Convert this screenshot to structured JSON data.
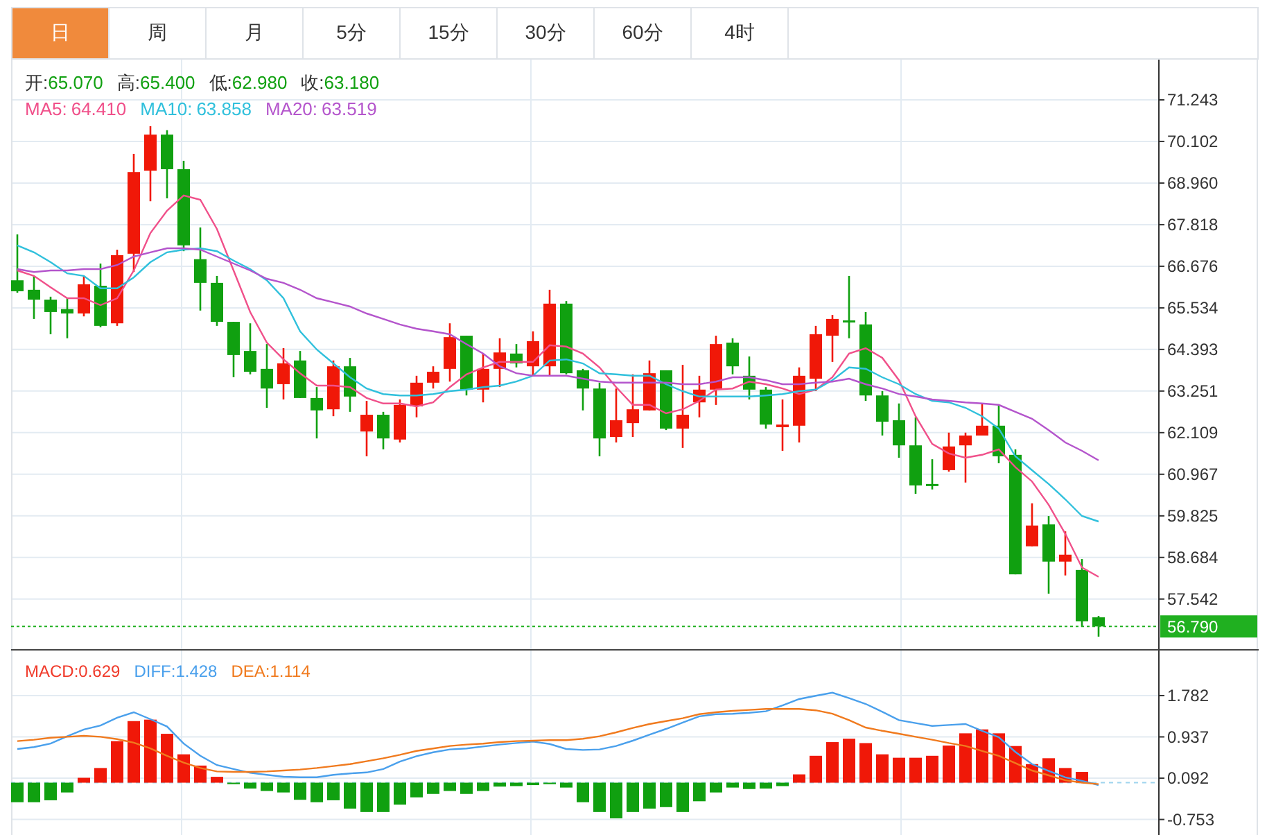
{
  "tabs": [
    {
      "label": "日",
      "selected": true
    },
    {
      "label": "周",
      "selected": false
    },
    {
      "label": "月",
      "selected": false
    },
    {
      "label": "5分",
      "selected": false
    },
    {
      "label": "15分",
      "selected": false
    },
    {
      "label": "30分",
      "selected": false
    },
    {
      "label": "60分",
      "selected": false
    },
    {
      "label": "4时",
      "selected": false
    }
  ],
  "price_chart": {
    "legend": {
      "ohlc": [
        {
          "label": "开:",
          "value": "65.070"
        },
        {
          "label": "高:",
          "value": "65.400"
        },
        {
          "label": "低:",
          "value": "62.980"
        },
        {
          "label": "收:",
          "value": "63.180"
        }
      ],
      "ma": [
        {
          "label": "MA5:",
          "value": "64.410",
          "color": "#f0508a"
        },
        {
          "label": "MA10:",
          "value": "63.858",
          "color": "#30c0dc"
        },
        {
          "label": "MA20:",
          "value": "63.519",
          "color": "#b455cc"
        }
      ]
    },
    "chart_data": {
      "type": "candlestick",
      "grid": true,
      "ylim": [
        56.167,
        72.347
      ],
      "yticks": [
        71.243,
        70.102,
        {
          "value": 68.96,
          "label": "68.960"
        },
        67.818,
        66.676,
        65.534,
        64.393,
        63.251,
        62.109,
        60.967,
        59.825,
        58.684,
        57.542
      ],
      "ref_lines": [
        {
          "axis": "y",
          "value": 56.79,
          "color": "#20b020",
          "label": "56.790"
        }
      ],
      "ohlc": [
        [
          66.29,
          67.55,
          65.95,
          65.99
        ],
        [
          66.03,
          66.41,
          65.23,
          65.76
        ],
        [
          65.76,
          65.84,
          64.81,
          65.42
        ],
        [
          65.5,
          65.8,
          64.7,
          65.38
        ],
        [
          65.38,
          66.41,
          65.3,
          66.18
        ],
        [
          66.14,
          66.75,
          65.0,
          65.04
        ],
        [
          65.11,
          67.13,
          65.04,
          66.98
        ],
        [
          67.02,
          69.76,
          66.52,
          69.26
        ],
        [
          69.3,
          70.52,
          68.46,
          70.29
        ],
        [
          70.29,
          70.41,
          68.54,
          69.34
        ],
        [
          69.34,
          69.57,
          67.09,
          67.25
        ],
        [
          66.87,
          67.74,
          65.46,
          66.22
        ],
        [
          66.22,
          66.41,
          65.04,
          65.15
        ],
        [
          65.15,
          65.15,
          63.63,
          64.24
        ],
        [
          64.35,
          65.11,
          63.71,
          63.78
        ],
        [
          63.86,
          64.54,
          62.79,
          63.32
        ],
        [
          63.44,
          64.43,
          63.02,
          64.01
        ],
        [
          64.09,
          64.35,
          63.06,
          63.06
        ],
        [
          63.06,
          63.36,
          61.95,
          62.72
        ],
        [
          62.75,
          64.09,
          62.56,
          63.93
        ],
        [
          63.93,
          64.16,
          62.68,
          63.1
        ],
        [
          62.14,
          62.98,
          61.46,
          62.6
        ],
        [
          62.6,
          62.68,
          61.65,
          61.95
        ],
        [
          61.92,
          63.02,
          61.84,
          62.87
        ],
        [
          62.83,
          63.67,
          62.53,
          63.48
        ],
        [
          63.48,
          63.93,
          63.32,
          63.78
        ],
        [
          63.86,
          65.11,
          63.51,
          64.73
        ],
        [
          64.77,
          64.77,
          63.13,
          63.29
        ],
        [
          63.29,
          64.28,
          62.94,
          63.86
        ],
        [
          63.86,
          64.7,
          63.36,
          64.31
        ],
        [
          64.28,
          64.54,
          63.9,
          64.01
        ],
        [
          63.93,
          64.89,
          63.67,
          64.62
        ],
        [
          63.93,
          66.03,
          63.67,
          65.65
        ],
        [
          65.65,
          65.72,
          63.71,
          63.74
        ],
        [
          63.82,
          63.86,
          62.72,
          63.32
        ],
        [
          63.32,
          63.48,
          61.46,
          61.95
        ],
        [
          61.99,
          63.32,
          61.84,
          62.45
        ],
        [
          62.37,
          63.71,
          61.99,
          62.75
        ],
        [
          62.72,
          64.09,
          62.72,
          63.74
        ],
        [
          63.82,
          63.82,
          62.18,
          62.22
        ],
        [
          62.22,
          63.97,
          61.69,
          62.6
        ],
        [
          62.94,
          63.67,
          62.53,
          63.29
        ],
        [
          63.29,
          64.77,
          62.87,
          64.54
        ],
        [
          64.58,
          64.7,
          63.71,
          63.93
        ],
        [
          63.67,
          64.2,
          63.02,
          63.29
        ],
        [
          63.29,
          63.36,
          62.22,
          62.33
        ],
        [
          62.26,
          63.02,
          61.61,
          62.33
        ],
        [
          62.3,
          63.9,
          61.84,
          63.67
        ],
        [
          63.59,
          65.04,
          63.25,
          64.81
        ],
        [
          64.77,
          65.34,
          64.05,
          65.23
        ],
        [
          65.19,
          66.41,
          64.7,
          65.15
        ],
        [
          65.08,
          65.42,
          62.98,
          63.13
        ],
        [
          63.13,
          63.25,
          62.03,
          62.41
        ],
        [
          62.45,
          62.91,
          61.42,
          61.76
        ],
        [
          61.76,
          62.53,
          60.43,
          60.66
        ],
        [
          60.7,
          61.38,
          60.55,
          60.66
        ],
        [
          61.08,
          62.11,
          61.04,
          61.73
        ],
        [
          61.76,
          62.11,
          60.74,
          62.03
        ],
        [
          62.03,
          62.91,
          62.03,
          62.3
        ],
        [
          62.3,
          62.87,
          61.27,
          61.46
        ],
        [
          61.5,
          61.65,
          58.22,
          58.22
        ],
        [
          58.99,
          60.17,
          58.99,
          59.56
        ],
        [
          59.59,
          59.82,
          57.69,
          58.57
        ],
        [
          58.57,
          59.4,
          58.19,
          58.76
        ],
        [
          58.34,
          58.64,
          56.78,
          56.93
        ],
        [
          57.04,
          57.08,
          56.51,
          56.79
        ]
      ],
      "series": [
        {
          "type": "line",
          "color": "#f0508a",
          "values": [
            66.56,
            66.41,
            66.1,
            65.8,
            65.8,
            65.61,
            65.8,
            66.56,
            67.59,
            68.2,
            68.62,
            68.5,
            67.7,
            66.56,
            65.42,
            64.58,
            64.12,
            63.74,
            63.4,
            63.4,
            63.36,
            63.06,
            62.91,
            62.91,
            62.83,
            62.94,
            63.36,
            63.71,
            63.9,
            64.05,
            64.05,
            64.05,
            64.51,
            64.47,
            64.28,
            63.9,
            63.36,
            62.87,
            62.87,
            62.64,
            62.75,
            62.98,
            63.29,
            63.32,
            63.51,
            63.44,
            63.32,
            63.17,
            63.29,
            63.63,
            64.28,
            64.43,
            64.16,
            63.55,
            62.56,
            61.8,
            61.54,
            61.42,
            61.5,
            61.65,
            61.16,
            60.77,
            60.13,
            59.33,
            58.41,
            58.15
          ]
        },
        {
          "type": "line",
          "color": "#30c0dc",
          "values": [
            67.25,
            67.06,
            66.79,
            66.48,
            66.41,
            66.07,
            66.07,
            66.37,
            66.79,
            67.06,
            67.13,
            67.17,
            67.09,
            66.83,
            66.6,
            66.29,
            65.8,
            64.89,
            64.39,
            64.01,
            63.63,
            63.32,
            63.17,
            63.13,
            63.13,
            63.17,
            63.25,
            63.29,
            63.36,
            63.4,
            63.51,
            63.67,
            64.09,
            64.12,
            64.01,
            63.74,
            63.71,
            63.67,
            63.67,
            63.44,
            63.25,
            63.1,
            63.1,
            63.1,
            63.1,
            63.13,
            63.17,
            63.25,
            63.29,
            63.55,
            63.9,
            63.86,
            63.63,
            63.44,
            63.17,
            62.98,
            62.94,
            62.79,
            62.56,
            62.22,
            61.46,
            61.08,
            60.7,
            60.28,
            59.82,
            59.67
          ]
        },
        {
          "type": "line",
          "color": "#b455cc",
          "values": [
            66.6,
            66.52,
            66.56,
            66.56,
            66.6,
            66.6,
            66.71,
            66.94,
            67.06,
            67.17,
            67.17,
            67.13,
            66.94,
            66.75,
            66.56,
            66.33,
            66.22,
            66.03,
            65.8,
            65.69,
            65.57,
            65.38,
            65.23,
            65.08,
            64.96,
            64.89,
            64.81,
            64.54,
            64.28,
            63.93,
            63.74,
            63.67,
            63.67,
            63.67,
            63.59,
            63.51,
            63.48,
            63.48,
            63.48,
            63.48,
            63.44,
            63.44,
            63.51,
            63.63,
            63.63,
            63.55,
            63.44,
            63.44,
            63.48,
            63.51,
            63.59,
            63.44,
            63.32,
            63.17,
            63.1,
            63.02,
            62.98,
            62.94,
            62.91,
            62.87,
            62.68,
            62.49,
            62.18,
            61.84,
            61.61,
            61.35
          ]
        }
      ]
    }
  },
  "macd_chart": {
    "legend": [
      {
        "label": "MACD:",
        "value": "0.629",
        "color": "#f03a2a"
      },
      {
        "label": "DIFF:",
        "value": "1.428",
        "color": "#4aa0ec"
      },
      {
        "label": "DEA:",
        "value": "1.114",
        "color": "#f07a1e"
      }
    ],
    "chart_data": {
      "type": "bar",
      "grid": true,
      "ylim": [
        -1.099,
        2.704
      ],
      "yticks": [
        1.782,
        0.937,
        0.092,
        -0.753
      ],
      "ref_lines": [
        {
          "axis": "y",
          "value": 0,
          "color": "#9fd4ee"
        }
      ],
      "series": [
        {
          "type": "bar",
          "color": "#f01808",
          "values": [
            null,
            null,
            null,
            null,
            0.1,
            0.3,
            0.85,
            1.26,
            1.29,
            1.0,
            0.58,
            0.35,
            0.12,
            null,
            null,
            null,
            null,
            null,
            null,
            null,
            null,
            null,
            null,
            null,
            null,
            null,
            null,
            null,
            null,
            null,
            null,
            null,
            null,
            null,
            null,
            null,
            null,
            null,
            null,
            null,
            null,
            null,
            null,
            null,
            null,
            null,
            null,
            0.17,
            0.55,
            0.83,
            0.9,
            0.81,
            0.58,
            0.51,
            0.51,
            0.55,
            0.76,
            1.01,
            1.09,
            1.01,
            0.75,
            0.38,
            0.5,
            0.3,
            0.22,
            null
          ]
        },
        {
          "type": "bar",
          "color": "#10a010",
          "values": [
            -0.4,
            -0.4,
            -0.36,
            -0.2,
            null,
            null,
            null,
            null,
            null,
            null,
            null,
            null,
            null,
            -0.03,
            -0.12,
            -0.17,
            -0.2,
            -0.35,
            -0.4,
            -0.36,
            -0.53,
            -0.6,
            -0.6,
            -0.45,
            -0.3,
            -0.23,
            -0.17,
            -0.23,
            -0.17,
            -0.08,
            -0.07,
            -0.05,
            -0.03,
            -0.1,
            -0.4,
            -0.6,
            -0.73,
            -0.6,
            -0.53,
            -0.5,
            -0.6,
            -0.38,
            -0.2,
            -0.1,
            -0.13,
            -0.12,
            -0.07,
            null,
            null,
            null,
            null,
            null,
            null,
            null,
            null,
            null,
            null,
            null,
            null,
            null,
            null,
            null,
            null,
            null,
            null,
            null
          ]
        },
        {
          "type": "line",
          "color": "#4aa0ec",
          "values": [
            0.69,
            0.73,
            0.8,
            0.95,
            1.09,
            1.17,
            1.33,
            1.44,
            1.3,
            1.15,
            0.8,
            0.55,
            0.36,
            0.28,
            0.2,
            0.16,
            0.12,
            0.11,
            0.11,
            0.16,
            0.19,
            0.21,
            0.28,
            0.43,
            0.54,
            0.62,
            0.68,
            0.7,
            0.74,
            0.78,
            0.81,
            0.84,
            0.79,
            0.69,
            0.67,
            0.68,
            0.75,
            0.86,
            0.98,
            1.1,
            1.23,
            1.36,
            1.4,
            1.41,
            1.43,
            1.46,
            1.58,
            1.71,
            1.78,
            1.84,
            1.73,
            1.61,
            1.45,
            1.28,
            1.22,
            1.16,
            1.18,
            1.2,
            1.06,
            0.93,
            0.63,
            0.38,
            0.24,
            0.11,
            0.04,
            -0.05
          ]
        },
        {
          "type": "line",
          "color": "#f07a1e",
          "values": [
            0.85,
            0.88,
            0.92,
            0.94,
            0.96,
            0.94,
            0.89,
            0.82,
            0.7,
            0.55,
            0.41,
            0.3,
            0.23,
            0.22,
            0.22,
            0.23,
            0.25,
            0.27,
            0.3,
            0.34,
            0.38,
            0.44,
            0.5,
            0.57,
            0.65,
            0.7,
            0.75,
            0.78,
            0.8,
            0.83,
            0.85,
            0.86,
            0.87,
            0.87,
            0.9,
            0.95,
            1.03,
            1.12,
            1.2,
            1.26,
            1.32,
            1.4,
            1.44,
            1.47,
            1.49,
            1.51,
            1.51,
            1.51,
            1.48,
            1.41,
            1.28,
            1.13,
            1.06,
            1.0,
            0.94,
            0.88,
            0.81,
            0.75,
            0.65,
            0.55,
            0.4,
            0.25,
            0.15,
            0.05,
            0.0,
            -0.03
          ]
        }
      ]
    }
  }
}
